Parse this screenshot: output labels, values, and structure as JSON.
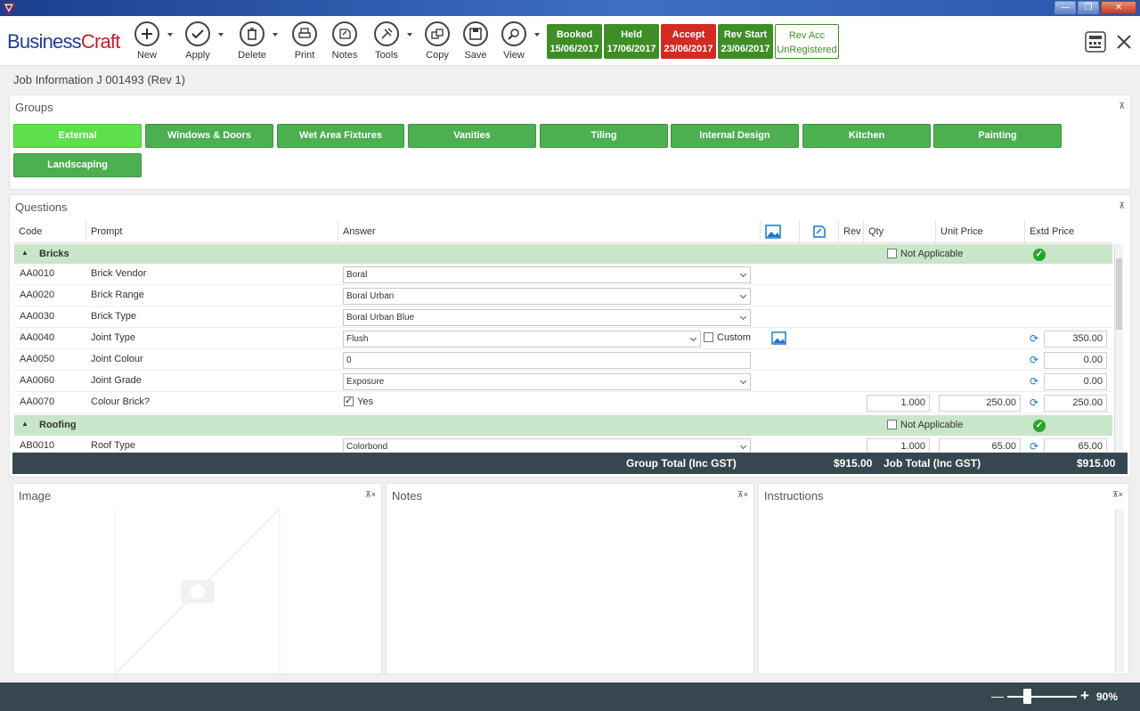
{
  "window": {
    "minimize": "—",
    "restore": "❐",
    "close": "✕"
  },
  "brand": {
    "part1": "Business",
    "part2": "Craft"
  },
  "toolbar": {
    "new": "New",
    "apply": "Apply",
    "delete": "Delete",
    "print": "Print",
    "notes": "Notes",
    "tools": "Tools",
    "copy": "Copy",
    "save": "Save",
    "view": "View"
  },
  "statuses": [
    {
      "label": "Booked",
      "date": "15/06/2017"
    },
    {
      "label": "Held",
      "date": "17/06/2017"
    },
    {
      "label": "Accept",
      "date": "23/06/2017"
    },
    {
      "label": "Rev Start",
      "date": "23/06/2017"
    },
    {
      "label": "Rev Acc",
      "date": "UnRegistered"
    }
  ],
  "breadcrumb": "Job Information J 001493 (Rev 1)",
  "groups": {
    "title": "Groups",
    "items": [
      "External",
      "Windows & Doors",
      "Wet Area Fixtures",
      "Vanities",
      "Tiling",
      "Internal Design",
      "Kitchen",
      "Painting",
      "Landscaping"
    ]
  },
  "questions": {
    "title": "Questions",
    "headers": {
      "code": "Code",
      "prompt": "Prompt",
      "answer": "Answer",
      "rev": "Rev",
      "qty": "Qty",
      "unit_price": "Unit Price",
      "extd_price": "Extd Price"
    },
    "sections": [
      {
        "name": "Bricks",
        "na": "Not Applicable"
      },
      {
        "name": "Roofing",
        "na": "Not Applicable"
      }
    ],
    "rows": [
      {
        "code": "AA0010",
        "prompt": "Brick Vendor",
        "answer": "Boral"
      },
      {
        "code": "AA0020",
        "prompt": "Brick Range",
        "answer": "Boral Urban"
      },
      {
        "code": "AA0030",
        "prompt": "Brick Type",
        "answer": "Boral Urban Blue"
      },
      {
        "code": "AA0040",
        "prompt": "Joint Type",
        "answer": "Flush",
        "custom": "Custom",
        "extd": "350.00"
      },
      {
        "code": "AA0050",
        "prompt": "Joint Colour",
        "answer": "0",
        "extd": "0.00"
      },
      {
        "code": "AA0060",
        "prompt": "Joint Grade",
        "answer": "Exposure",
        "extd": "0.00"
      },
      {
        "code": "AA0070",
        "prompt": "Colour Brick?",
        "answer": "Yes",
        "qty": "1.000",
        "unit": "250.00",
        "extd": "250.00"
      },
      {
        "code": "AB0010",
        "prompt": "Roof Type",
        "answer": "Colorbond",
        "qty": "1.000",
        "unit": "65.00",
        "extd": "65.00"
      }
    ]
  },
  "totals": {
    "group_label": "Group Total (Inc GST)",
    "group_value": "$915.00",
    "job_label": "Job Total (Inc GST)",
    "job_value": "$915.00"
  },
  "panels": {
    "image": "Image",
    "notes": "Notes",
    "instructions": "Instructions"
  },
  "pin_close": "⊼×",
  "pin": "⊼",
  "zoom": {
    "minus": "—",
    "plus": "+",
    "value": "90%"
  }
}
